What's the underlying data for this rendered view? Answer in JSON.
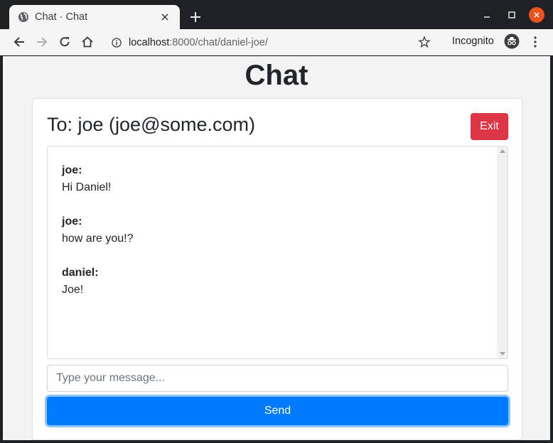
{
  "browser": {
    "tab_title": "Chat · Chat",
    "url_host": "localhost",
    "url_path": ":8000/chat/daniel-joe/",
    "incognito_label": "Incognito"
  },
  "page": {
    "title": "Chat",
    "recipient": "To: joe (joe@some.com)",
    "exit_label": "Exit",
    "messages": [
      {
        "author": "joe:",
        "text": "Hi Daniel!"
      },
      {
        "author": "joe:",
        "text": "how are you!?"
      },
      {
        "author": "daniel:",
        "text": "Joe!"
      }
    ],
    "input_placeholder": "Type your message...",
    "input_value": "",
    "send_label": "Send"
  },
  "colors": {
    "exit_button": "#dc3545",
    "send_button": "#007bff",
    "window_close": "#e95420"
  }
}
